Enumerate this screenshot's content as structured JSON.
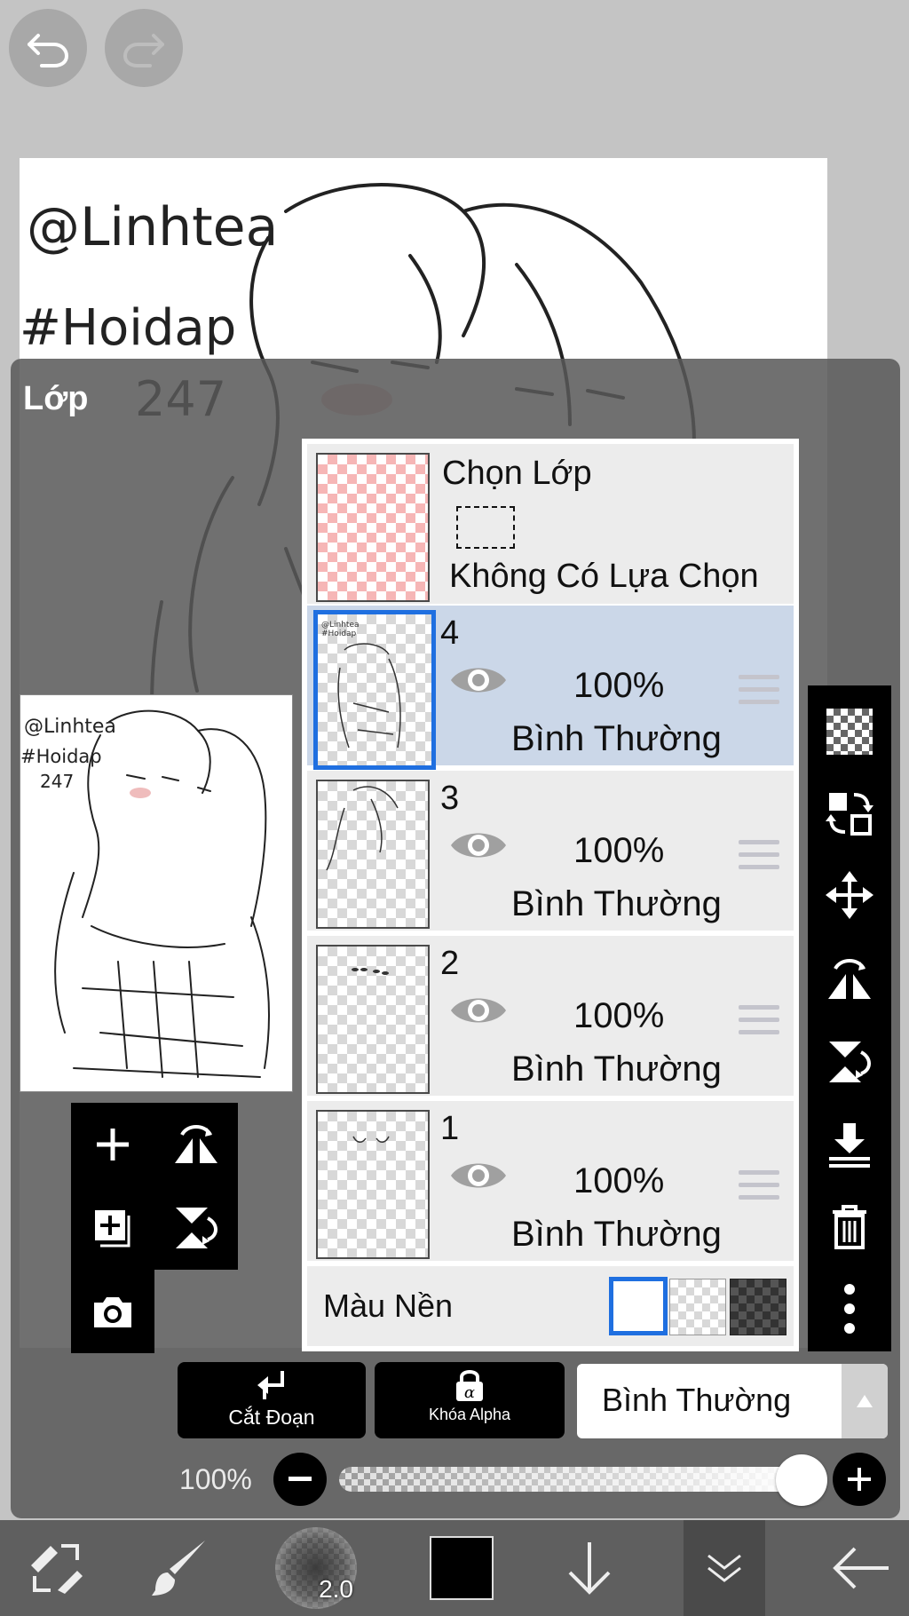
{
  "top": {
    "undo_icon": "undo-icon",
    "redo_icon": "redo-icon"
  },
  "canvas": {
    "sketch_text": [
      "@Linhtea",
      "#Hoidap",
      "247"
    ]
  },
  "panel": {
    "title": "Lớp"
  },
  "selection_layer": {
    "title": "Chọn Lớp",
    "status": "Không Có Lựa Chọn"
  },
  "layers": [
    {
      "number": "4",
      "opacity": "100%",
      "blend": "Bình Thường",
      "selected": true
    },
    {
      "number": "3",
      "opacity": "100%",
      "blend": "Bình Thường",
      "selected": false
    },
    {
      "number": "2",
      "opacity": "100%",
      "blend": "Bình Thường",
      "selected": false
    },
    {
      "number": "1",
      "opacity": "100%",
      "blend": "Bình Thường",
      "selected": false
    }
  ],
  "background": {
    "label": "Màu Nền",
    "options": [
      "white",
      "transparent",
      "dark"
    ],
    "selected": "white"
  },
  "preview_text": [
    "@Linhtea",
    "#Hoidap",
    "247"
  ],
  "actions": {
    "clipping_label": "Cắt Đoạn",
    "alpha_lock_label": "Khóa Alpha",
    "blend_mode_value": "Bình Thường"
  },
  "opacity_slider": {
    "label": "100%",
    "value": 100
  },
  "brush": {
    "size": "2.0"
  },
  "colors": {
    "accent": "#1f6fe0",
    "selected_row": "#cbd7e8",
    "current_color": "#000000"
  }
}
